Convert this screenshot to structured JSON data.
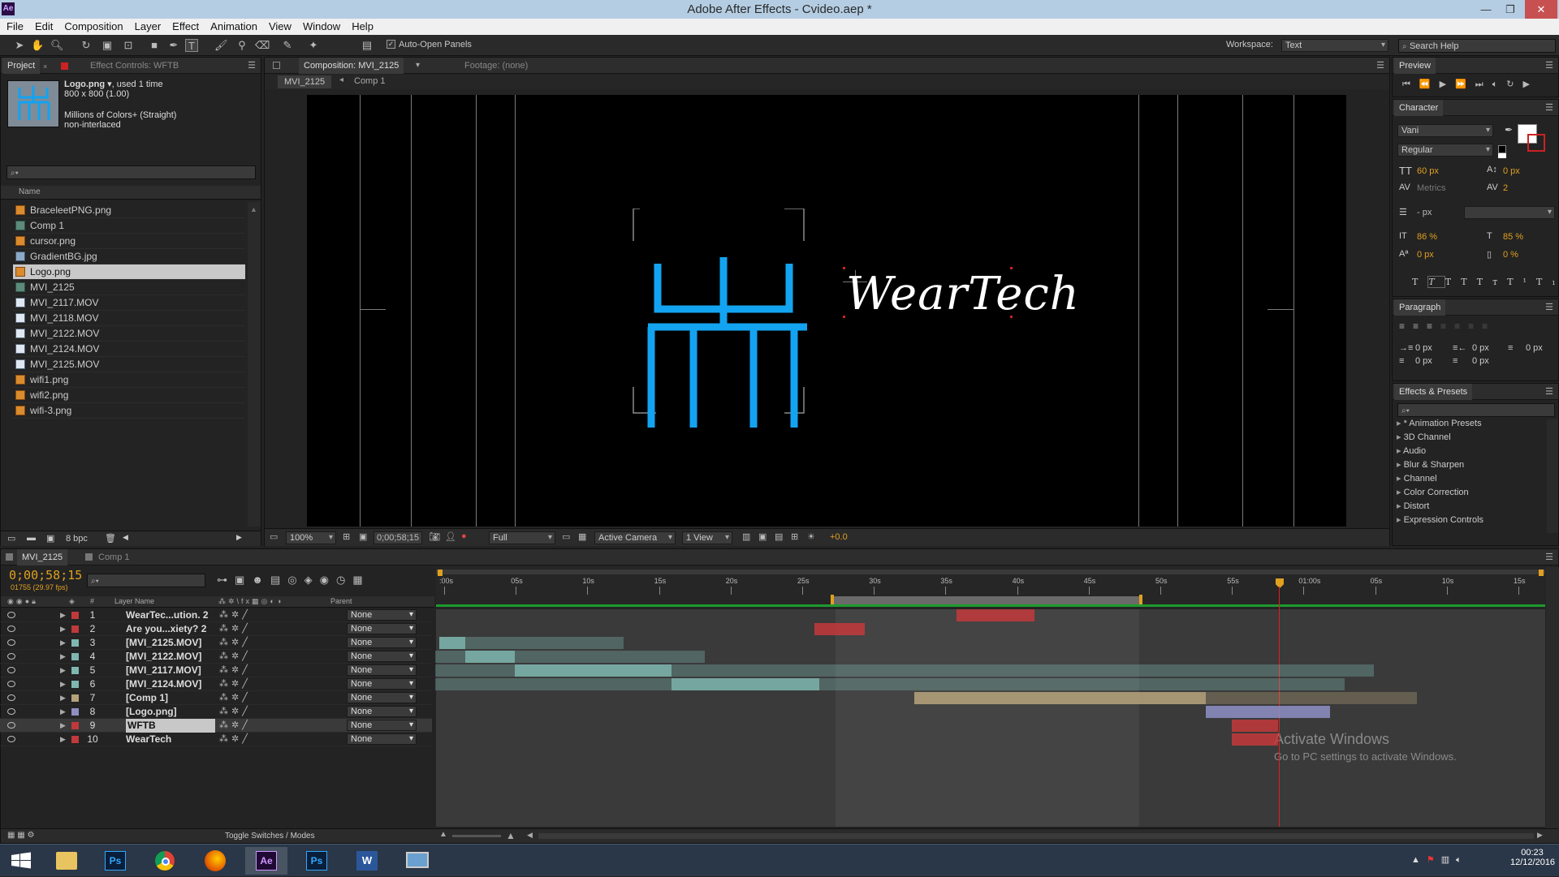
{
  "window": {
    "title": "Adobe After Effects - Cvideo.aep *",
    "app_badge": "Ae"
  },
  "menu": [
    "File",
    "Edit",
    "Composition",
    "Layer",
    "Effect",
    "Animation",
    "View",
    "Window",
    "Help"
  ],
  "toolbar": {
    "auto_open_label": "Auto-Open Panels",
    "workspace_label": "Workspace:",
    "workspace_value": "Text",
    "search_placeholder": "Search Help"
  },
  "project": {
    "tab_project": "Project",
    "tab_effect_controls": "Effect Controls: WFTB",
    "info": {
      "name": "Logo.png",
      "used": ", used 1 time",
      "dims": "800 x 800 (1.00)",
      "colors": "Millions of Colors+ (Straight)",
      "interlace": "non-interlaced"
    },
    "col_name": "Name",
    "items": [
      {
        "name": "BraceleetPNG.png",
        "type": "png"
      },
      {
        "name": "Comp 1",
        "type": "comp"
      },
      {
        "name": "cursor.png",
        "type": "png"
      },
      {
        "name": "GradientBG.jpg",
        "type": "jpg"
      },
      {
        "name": "Logo.png",
        "type": "png",
        "selected": true
      },
      {
        "name": "MVI_2125",
        "type": "comp"
      },
      {
        "name": "MVI_2117.MOV",
        "type": "mov"
      },
      {
        "name": "MVI_2118.MOV",
        "type": "mov"
      },
      {
        "name": "MVI_2122.MOV",
        "type": "mov"
      },
      {
        "name": "MVI_2124.MOV",
        "type": "mov"
      },
      {
        "name": "MVI_2125.MOV",
        "type": "mov"
      },
      {
        "name": "wifi1.png",
        "type": "png"
      },
      {
        "name": "wifi2.png",
        "type": "png"
      },
      {
        "name": "wifi-3.png",
        "type": "png"
      }
    ],
    "bpc": "8 bpc"
  },
  "comp": {
    "tab_comp": "Composition: MVI_2125",
    "tab_footage": "Footage: (none)",
    "crumb1": "MVI_2125",
    "crumb2": "Comp 1",
    "logo_text": "WearTech",
    "zoom": "100%",
    "timecode": "0;00;58;15",
    "resolution": "Full",
    "camera": "Active Camera",
    "views": "1 View",
    "exposure": "+0.0"
  },
  "preview": {
    "title": "Preview"
  },
  "character": {
    "title": "Character",
    "font": "Vani",
    "style": "Regular",
    "size": "60 px",
    "leading": "0 px",
    "kerning": "Metrics",
    "tracking": "2",
    "stroke": "- px",
    "vscale": "86 %",
    "hscale": "85 %",
    "baseline": "0 px",
    "tsume": "0 %"
  },
  "paragraph": {
    "title": "Paragraph",
    "v1": "0 px",
    "v2": "0 px",
    "v3": "0 px",
    "v4": "0 px",
    "v5": "0 px"
  },
  "effects": {
    "title": "Effects & Presets",
    "items": [
      "* Animation Presets",
      "3D Channel",
      "Audio",
      "Blur & Sharpen",
      "Channel",
      "Color Correction",
      "Distort",
      "Expression Controls"
    ]
  },
  "timeline": {
    "tab1": "MVI_2125",
    "tab2": "Comp 1",
    "timecode": "0;00;58;15",
    "frames": "01755 (29.97 fps)",
    "col_num": "#",
    "col_layer": "Layer Name",
    "col_parent": "Parent",
    "ruler": [
      ":00s",
      "05s",
      "10s",
      "15s",
      "20s",
      "25s",
      "30s",
      "35s",
      "40s",
      "45s",
      "50s",
      "55s",
      "01:00s",
      "05s",
      "10s",
      "15s"
    ],
    "layers": [
      {
        "num": "1",
        "name": "WearTec...ution. 2",
        "color": "#c0393b",
        "parent": "None",
        "start": 0.47,
        "end": 0.54,
        "bg_start": 0.47,
        "bg_end": 0.54
      },
      {
        "num": "2",
        "name": "Are you...xiety? 2",
        "color": "#c0393b",
        "parent": "None",
        "start": 0.342,
        "end": 0.387,
        "bg_start": 0.342,
        "bg_end": 0.387
      },
      {
        "num": "3",
        "name": "[MVI_2125.MOV]",
        "color": "#7fb7b0",
        "parent": "None",
        "start": 0.004,
        "end": 0.027,
        "bg_start": 0.004,
        "bg_end": 0.17
      },
      {
        "num": "4",
        "name": "[MVI_2122.MOV]",
        "color": "#7fb7b0",
        "parent": "None",
        "start": 0.027,
        "end": 0.072,
        "bg_start": 0.0,
        "bg_end": 0.243
      },
      {
        "num": "5",
        "name": "[MVI_2117.MOV]",
        "color": "#7fb7b0",
        "parent": "None",
        "start": 0.072,
        "end": 0.213,
        "bg_start": 0.0,
        "bg_end": 0.846
      },
      {
        "num": "6",
        "name": "[MVI_2124.MOV]",
        "color": "#7fb7b0",
        "parent": "None",
        "start": 0.213,
        "end": 0.346,
        "bg_start": 0.0,
        "bg_end": 0.82
      },
      {
        "num": "7",
        "name": "[Comp 1]",
        "color": "#b5a27a",
        "parent": "None",
        "start": 0.432,
        "end": 0.695,
        "bg_start": 0.432,
        "bg_end": 0.885
      },
      {
        "num": "8",
        "name": "[Logo.png]",
        "color": "#8f8fc4",
        "parent": "None",
        "start": 0.695,
        "end": 0.807,
        "bg_start": 0.695,
        "bg_end": 0.807
      },
      {
        "num": "9",
        "name": "WFTB",
        "color": "#c0393b",
        "parent": "None",
        "start": 0.718,
        "end": 0.76,
        "bg_start": 0.718,
        "bg_end": 0.76
      },
      {
        "num": "10",
        "name": "WearTech",
        "color": "#c0393b",
        "parent": "None",
        "start": 0.718,
        "end": 0.76,
        "bg_start": 0.718,
        "bg_end": 0.76
      }
    ],
    "toggle_label": "Toggle Switches / Modes"
  },
  "activate": {
    "line1": "Activate Windows",
    "line2": "Go to PC settings to activate Windows."
  },
  "taskbar": {
    "time": "00:23",
    "date": "12/12/2016"
  }
}
